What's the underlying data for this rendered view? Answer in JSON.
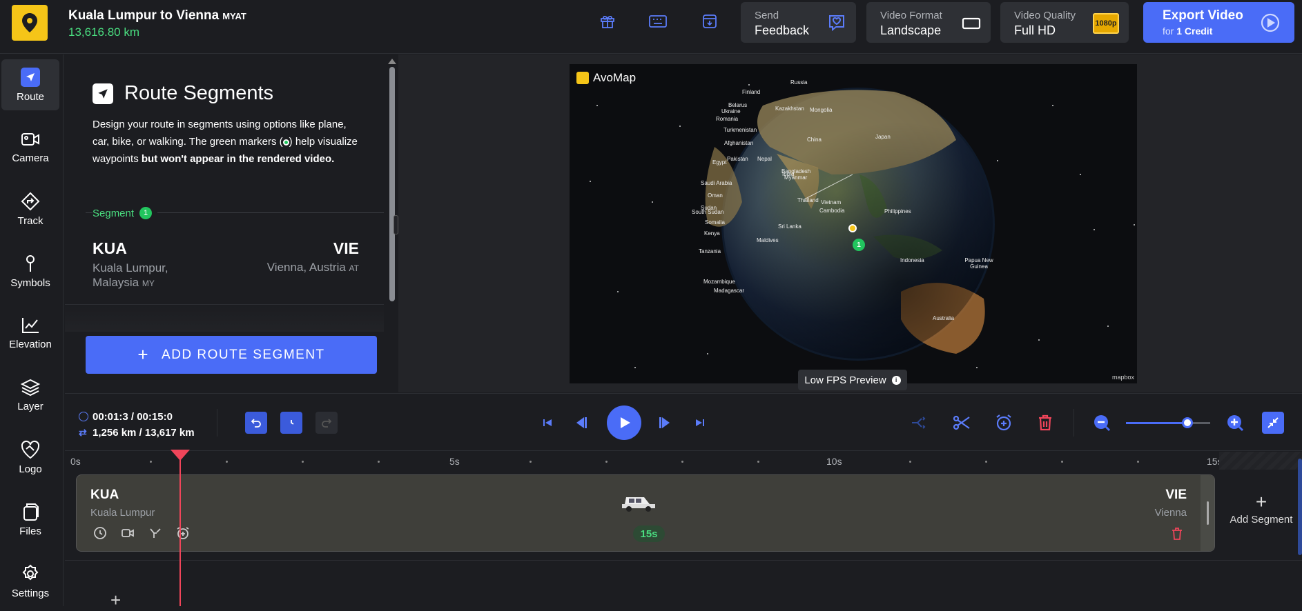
{
  "header": {
    "title": "Kuala Lumpur to Vienna",
    "title_codes": "MYAT",
    "distance": "13,616.80 km",
    "feedback": {
      "line1": "Send",
      "line2": "Feedback"
    },
    "format": {
      "line1": "Video Format",
      "line2": "Landscape"
    },
    "quality": {
      "line1": "Video Quality",
      "line2": "Full HD",
      "badge": "1080p"
    },
    "export": {
      "line1": "Export Video",
      "line2_prefix": "for ",
      "line2_bold": "1 Credit"
    }
  },
  "sidebar": {
    "items": [
      {
        "label": "Route"
      },
      {
        "label": "Camera"
      },
      {
        "label": "Track"
      },
      {
        "label": "Symbols"
      },
      {
        "label": "Elevation"
      },
      {
        "label": "Layer"
      },
      {
        "label": "Logo"
      },
      {
        "label": "Files"
      },
      {
        "label": "Settings"
      }
    ]
  },
  "panel": {
    "title": "Route Segments",
    "desc_part1": "Design your route in segments using options like plane, car, bike, or walking. The green markers (",
    "desc_part2": ") help visualize waypoints ",
    "desc_bold": "but won't appear in the rendered video.",
    "segment_label": "Segment",
    "segment_number": "1",
    "from_code": "KUA",
    "from_city": "Kuala Lumpur, Malaysia",
    "from_country": "MY",
    "to_code": "VIE",
    "to_city": "Vienna, Austria",
    "to_country": "AT",
    "add_button": "ADD ROUTE SEGMENT"
  },
  "preview": {
    "brand": "AvoMap",
    "fps_label": "Low FPS Preview",
    "attribution": "mapbox",
    "marker_number": "1",
    "labels": [
      {
        "t": "Russia"
      },
      {
        "t": "Finland"
      },
      {
        "t": "Belarus"
      },
      {
        "t": "Kazakhstan"
      },
      {
        "t": "Ukraine"
      },
      {
        "t": "Mongolia"
      },
      {
        "t": "Romania"
      },
      {
        "t": "Turkmenistan"
      },
      {
        "t": "China"
      },
      {
        "t": "Japan"
      },
      {
        "t": "Afghanistan"
      },
      {
        "t": "Pakistan"
      },
      {
        "t": "Nepal"
      },
      {
        "t": "Egypt"
      },
      {
        "t": "India"
      },
      {
        "t": "Bangladesh"
      },
      {
        "t": "Saudi Arabia"
      },
      {
        "t": "Myanmar"
      },
      {
        "t": "Oman"
      },
      {
        "t": "Thailand"
      },
      {
        "t": "Vietnam"
      },
      {
        "t": "Sudan"
      },
      {
        "t": "Cambodia"
      },
      {
        "t": "Philippines"
      },
      {
        "t": "South Sudan"
      },
      {
        "t": "Somalia"
      },
      {
        "t": "Sri Lanka"
      },
      {
        "t": "Kenya"
      },
      {
        "t": "Maldives"
      },
      {
        "t": "Tanzania"
      },
      {
        "t": "Indonesia"
      },
      {
        "t": "Papua New Guinea"
      },
      {
        "t": "Mozambique"
      },
      {
        "t": "Madagascar"
      },
      {
        "t": "Australia"
      }
    ]
  },
  "controls": {
    "time": "00:01:3 / 00:15:0",
    "distance": "1,256 km / 13,617 km",
    "zoom_level": 0.72
  },
  "timeline": {
    "ruler": [
      "0s",
      "5s",
      "10s",
      "15s"
    ],
    "segment": {
      "from_code": "KUA",
      "from_city": "Kuala Lumpur",
      "to_code": "VIE",
      "to_city": "Vienna",
      "duration": "15s"
    },
    "add_segment": "Add Segment"
  }
}
